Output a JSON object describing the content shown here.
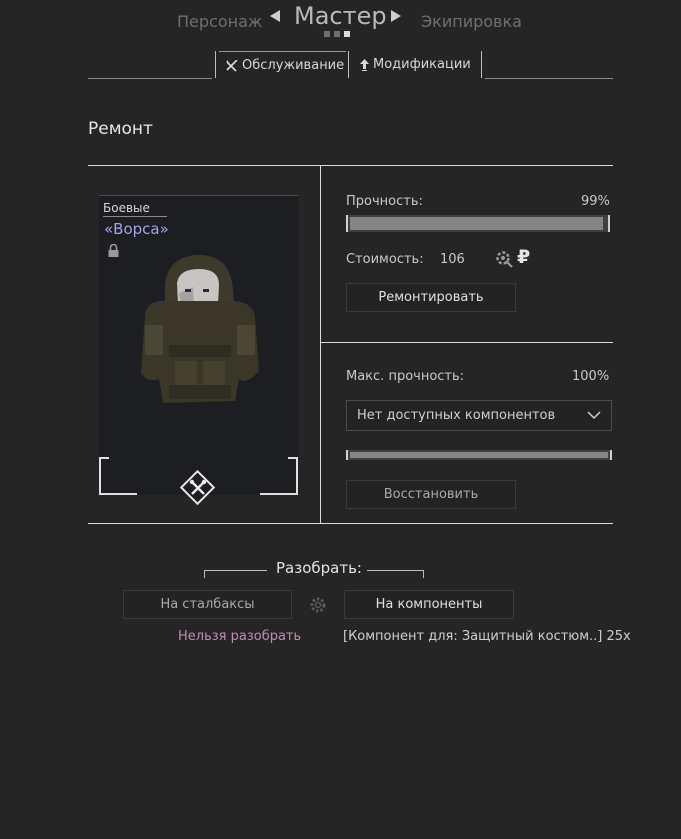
{
  "top_nav": {
    "left": "Персонаж",
    "center": "Мастер",
    "right": "Экипировка",
    "page_index": 3,
    "page_count": 3
  },
  "tabs": [
    {
      "label": "Обслуживание",
      "icon": "wrench-screwdriver-icon",
      "active": true
    },
    {
      "label": "Модификации",
      "icon": "upgrade-arrow-icon",
      "active": false
    }
  ],
  "section_title": "Ремонт",
  "item": {
    "category": "Боевые",
    "name": "«Ворса»",
    "locked_icon": "lock-icon",
    "action_icon": "repair-tools-icon"
  },
  "repair": {
    "durability_label": "Прочность:",
    "durability_value": "99%",
    "durability_fraction": 0.99,
    "cost_label": "Стоимость:",
    "cost_value": "106",
    "cost_icons": [
      "gear-repair-icon",
      "ruble-icon"
    ],
    "repair_button": "Ремонтировать"
  },
  "restore": {
    "max_label": "Макс. прочность:",
    "max_value": "100%",
    "max_fraction": 1.0,
    "component_select": "Нет доступных компонентов",
    "restore_button": "Восстановить"
  },
  "disassemble": {
    "title": "Разобрать:",
    "stalbucks_button": "На сталбаксы",
    "components_button": "На компоненты",
    "cannot_text": "Нельзя разобрать",
    "component_info": "[Компонент для: Защитный костюм..] 25х"
  },
  "colors": {
    "accent_purple": "#a9a0ea",
    "warn_pink": "#c48ab0"
  }
}
